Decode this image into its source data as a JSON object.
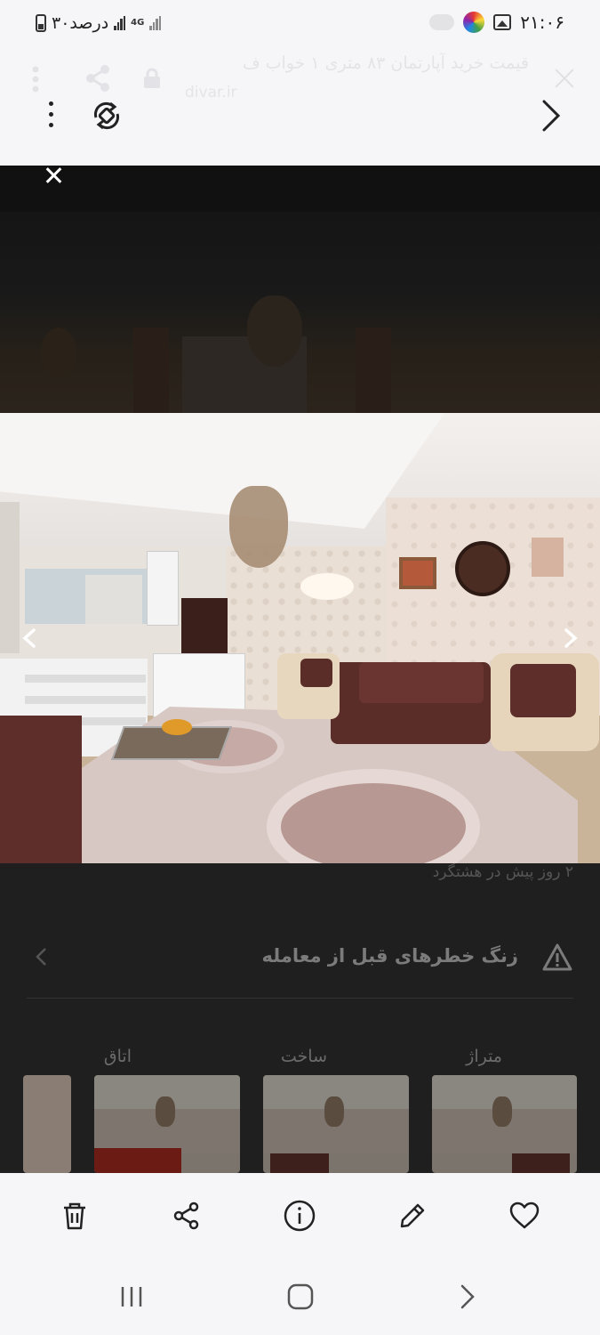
{
  "status_bar": {
    "battery_text": "۳۰درصد",
    "network": "4G",
    "time": "۲۱:۰۶"
  },
  "browser": {
    "page_title": "قیمت خرید آپارتمان ۸۳ متری ۱ خواب ف",
    "page_url": "divar.ir"
  },
  "listing": {
    "posted": "۲ روز پیش در هشتگرد",
    "safety_title": "زنگ خطرهای قبل از معامله",
    "thumbnails": [
      {
        "caption": "متراژ"
      },
      {
        "caption": "ساخت"
      },
      {
        "caption": "اتاق"
      },
      {
        "caption": ""
      }
    ]
  },
  "icons": {
    "status": [
      "battery-icon",
      "signal-icon",
      "toggle-icon",
      "game-launcher-icon",
      "gallery-icon"
    ],
    "chrome": [
      "more-vert-icon",
      "rotate-icon",
      "forward-chevron-icon",
      "share-icon",
      "lock-icon",
      "close-icon"
    ],
    "photo_nav": [
      "chevron-left-icon",
      "chevron-right-icon"
    ],
    "actions": [
      "delete-icon",
      "share-icon",
      "info-icon",
      "edit-icon",
      "favorite-icon"
    ],
    "system_nav": [
      "recents-icon",
      "home-icon",
      "back-icon"
    ]
  },
  "colors": {
    "background": "#f6f6f8",
    "overlay": "#1f1f1f",
    "icon": "#222222"
  }
}
